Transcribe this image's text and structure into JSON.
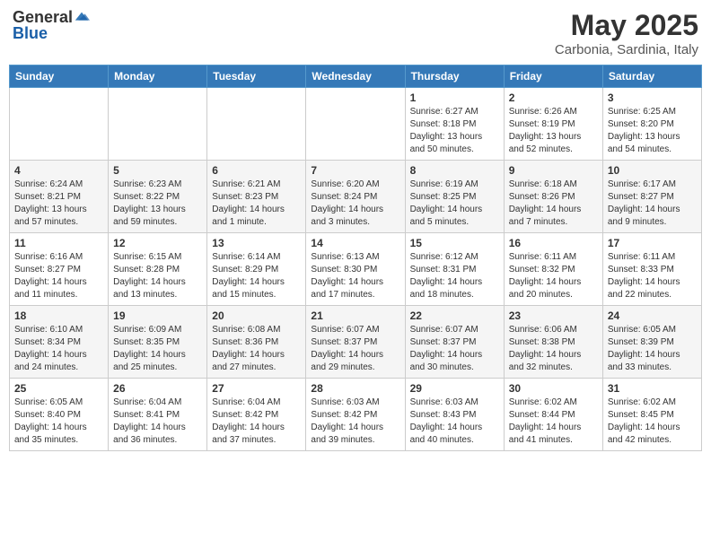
{
  "header": {
    "logo_general": "General",
    "logo_blue": "Blue",
    "title": "May 2025",
    "subtitle": "Carbonia, Sardinia, Italy"
  },
  "days_of_week": [
    "Sunday",
    "Monday",
    "Tuesday",
    "Wednesday",
    "Thursday",
    "Friday",
    "Saturday"
  ],
  "weeks": [
    [
      {
        "day": "",
        "info": ""
      },
      {
        "day": "",
        "info": ""
      },
      {
        "day": "",
        "info": ""
      },
      {
        "day": "",
        "info": ""
      },
      {
        "day": "1",
        "info": "Sunrise: 6:27 AM\nSunset: 8:18 PM\nDaylight: 13 hours and 50 minutes."
      },
      {
        "day": "2",
        "info": "Sunrise: 6:26 AM\nSunset: 8:19 PM\nDaylight: 13 hours and 52 minutes."
      },
      {
        "day": "3",
        "info": "Sunrise: 6:25 AM\nSunset: 8:20 PM\nDaylight: 13 hours and 54 minutes."
      }
    ],
    [
      {
        "day": "4",
        "info": "Sunrise: 6:24 AM\nSunset: 8:21 PM\nDaylight: 13 hours and 57 minutes."
      },
      {
        "day": "5",
        "info": "Sunrise: 6:23 AM\nSunset: 8:22 PM\nDaylight: 13 hours and 59 minutes."
      },
      {
        "day": "6",
        "info": "Sunrise: 6:21 AM\nSunset: 8:23 PM\nDaylight: 14 hours and 1 minute."
      },
      {
        "day": "7",
        "info": "Sunrise: 6:20 AM\nSunset: 8:24 PM\nDaylight: 14 hours and 3 minutes."
      },
      {
        "day": "8",
        "info": "Sunrise: 6:19 AM\nSunset: 8:25 PM\nDaylight: 14 hours and 5 minutes."
      },
      {
        "day": "9",
        "info": "Sunrise: 6:18 AM\nSunset: 8:26 PM\nDaylight: 14 hours and 7 minutes."
      },
      {
        "day": "10",
        "info": "Sunrise: 6:17 AM\nSunset: 8:27 PM\nDaylight: 14 hours and 9 minutes."
      }
    ],
    [
      {
        "day": "11",
        "info": "Sunrise: 6:16 AM\nSunset: 8:27 PM\nDaylight: 14 hours and 11 minutes."
      },
      {
        "day": "12",
        "info": "Sunrise: 6:15 AM\nSunset: 8:28 PM\nDaylight: 14 hours and 13 minutes."
      },
      {
        "day": "13",
        "info": "Sunrise: 6:14 AM\nSunset: 8:29 PM\nDaylight: 14 hours and 15 minutes."
      },
      {
        "day": "14",
        "info": "Sunrise: 6:13 AM\nSunset: 8:30 PM\nDaylight: 14 hours and 17 minutes."
      },
      {
        "day": "15",
        "info": "Sunrise: 6:12 AM\nSunset: 8:31 PM\nDaylight: 14 hours and 18 minutes."
      },
      {
        "day": "16",
        "info": "Sunrise: 6:11 AM\nSunset: 8:32 PM\nDaylight: 14 hours and 20 minutes."
      },
      {
        "day": "17",
        "info": "Sunrise: 6:11 AM\nSunset: 8:33 PM\nDaylight: 14 hours and 22 minutes."
      }
    ],
    [
      {
        "day": "18",
        "info": "Sunrise: 6:10 AM\nSunset: 8:34 PM\nDaylight: 14 hours and 24 minutes."
      },
      {
        "day": "19",
        "info": "Sunrise: 6:09 AM\nSunset: 8:35 PM\nDaylight: 14 hours and 25 minutes."
      },
      {
        "day": "20",
        "info": "Sunrise: 6:08 AM\nSunset: 8:36 PM\nDaylight: 14 hours and 27 minutes."
      },
      {
        "day": "21",
        "info": "Sunrise: 6:07 AM\nSunset: 8:37 PM\nDaylight: 14 hours and 29 minutes."
      },
      {
        "day": "22",
        "info": "Sunrise: 6:07 AM\nSunset: 8:37 PM\nDaylight: 14 hours and 30 minutes."
      },
      {
        "day": "23",
        "info": "Sunrise: 6:06 AM\nSunset: 8:38 PM\nDaylight: 14 hours and 32 minutes."
      },
      {
        "day": "24",
        "info": "Sunrise: 6:05 AM\nSunset: 8:39 PM\nDaylight: 14 hours and 33 minutes."
      }
    ],
    [
      {
        "day": "25",
        "info": "Sunrise: 6:05 AM\nSunset: 8:40 PM\nDaylight: 14 hours and 35 minutes."
      },
      {
        "day": "26",
        "info": "Sunrise: 6:04 AM\nSunset: 8:41 PM\nDaylight: 14 hours and 36 minutes."
      },
      {
        "day": "27",
        "info": "Sunrise: 6:04 AM\nSunset: 8:42 PM\nDaylight: 14 hours and 37 minutes."
      },
      {
        "day": "28",
        "info": "Sunrise: 6:03 AM\nSunset: 8:42 PM\nDaylight: 14 hours and 39 minutes."
      },
      {
        "day": "29",
        "info": "Sunrise: 6:03 AM\nSunset: 8:43 PM\nDaylight: 14 hours and 40 minutes."
      },
      {
        "day": "30",
        "info": "Sunrise: 6:02 AM\nSunset: 8:44 PM\nDaylight: 14 hours and 41 minutes."
      },
      {
        "day": "31",
        "info": "Sunrise: 6:02 AM\nSunset: 8:45 PM\nDaylight: 14 hours and 42 minutes."
      }
    ]
  ]
}
